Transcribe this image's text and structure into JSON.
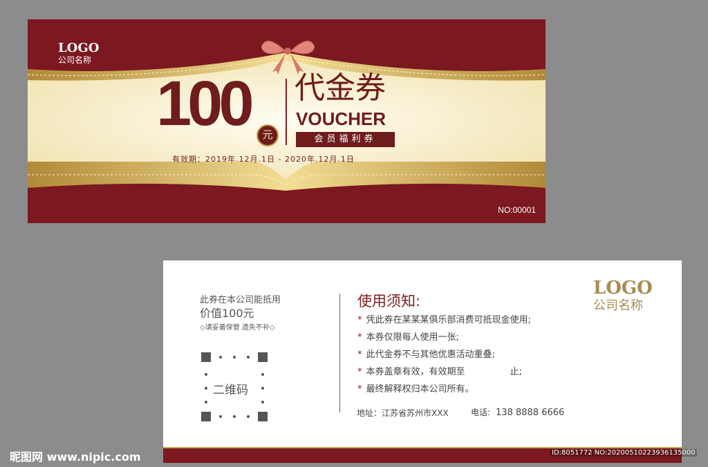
{
  "front": {
    "logo": "LOGO",
    "company": "公司名称",
    "amount": "100",
    "currency": "元",
    "title_cn": "代金券",
    "title_en": "VOUCHER",
    "member_tag": "会员福利券",
    "validity": "有效期：2019年.12月.1日 - 2020年.12月.1日",
    "serial": "NO:00001",
    "colors": {
      "maroon": "#7b1820",
      "gold": "#c9a54a",
      "cream": "#faf3d6"
    }
  },
  "back": {
    "note_line1": "此券在本公司能抵用",
    "note_line2": "价值100元",
    "note_line3": "◇请妥善保管 遗失不补◇",
    "qr_label": "二维码",
    "notice_title": "使用须知:",
    "notice_items": [
      "凭此券在某某某俱乐部消费可抵现金使用;",
      "本券仅限每人使用一张;",
      "此代金券不与其他优惠活动重叠;",
      "本券盖章有效，有效期至　　　　　止;",
      "最终解释权归本公司所有。"
    ],
    "address_label": "地址：江苏省苏州市XXX",
    "phone_label": "电话:",
    "phone": "138 8888 6666",
    "logo": "LOGO",
    "company": "公司名称"
  },
  "watermark": {
    "site": "昵图网 www.nipic.com",
    "id": "ID:8051772 NO:20200510223936135000"
  }
}
